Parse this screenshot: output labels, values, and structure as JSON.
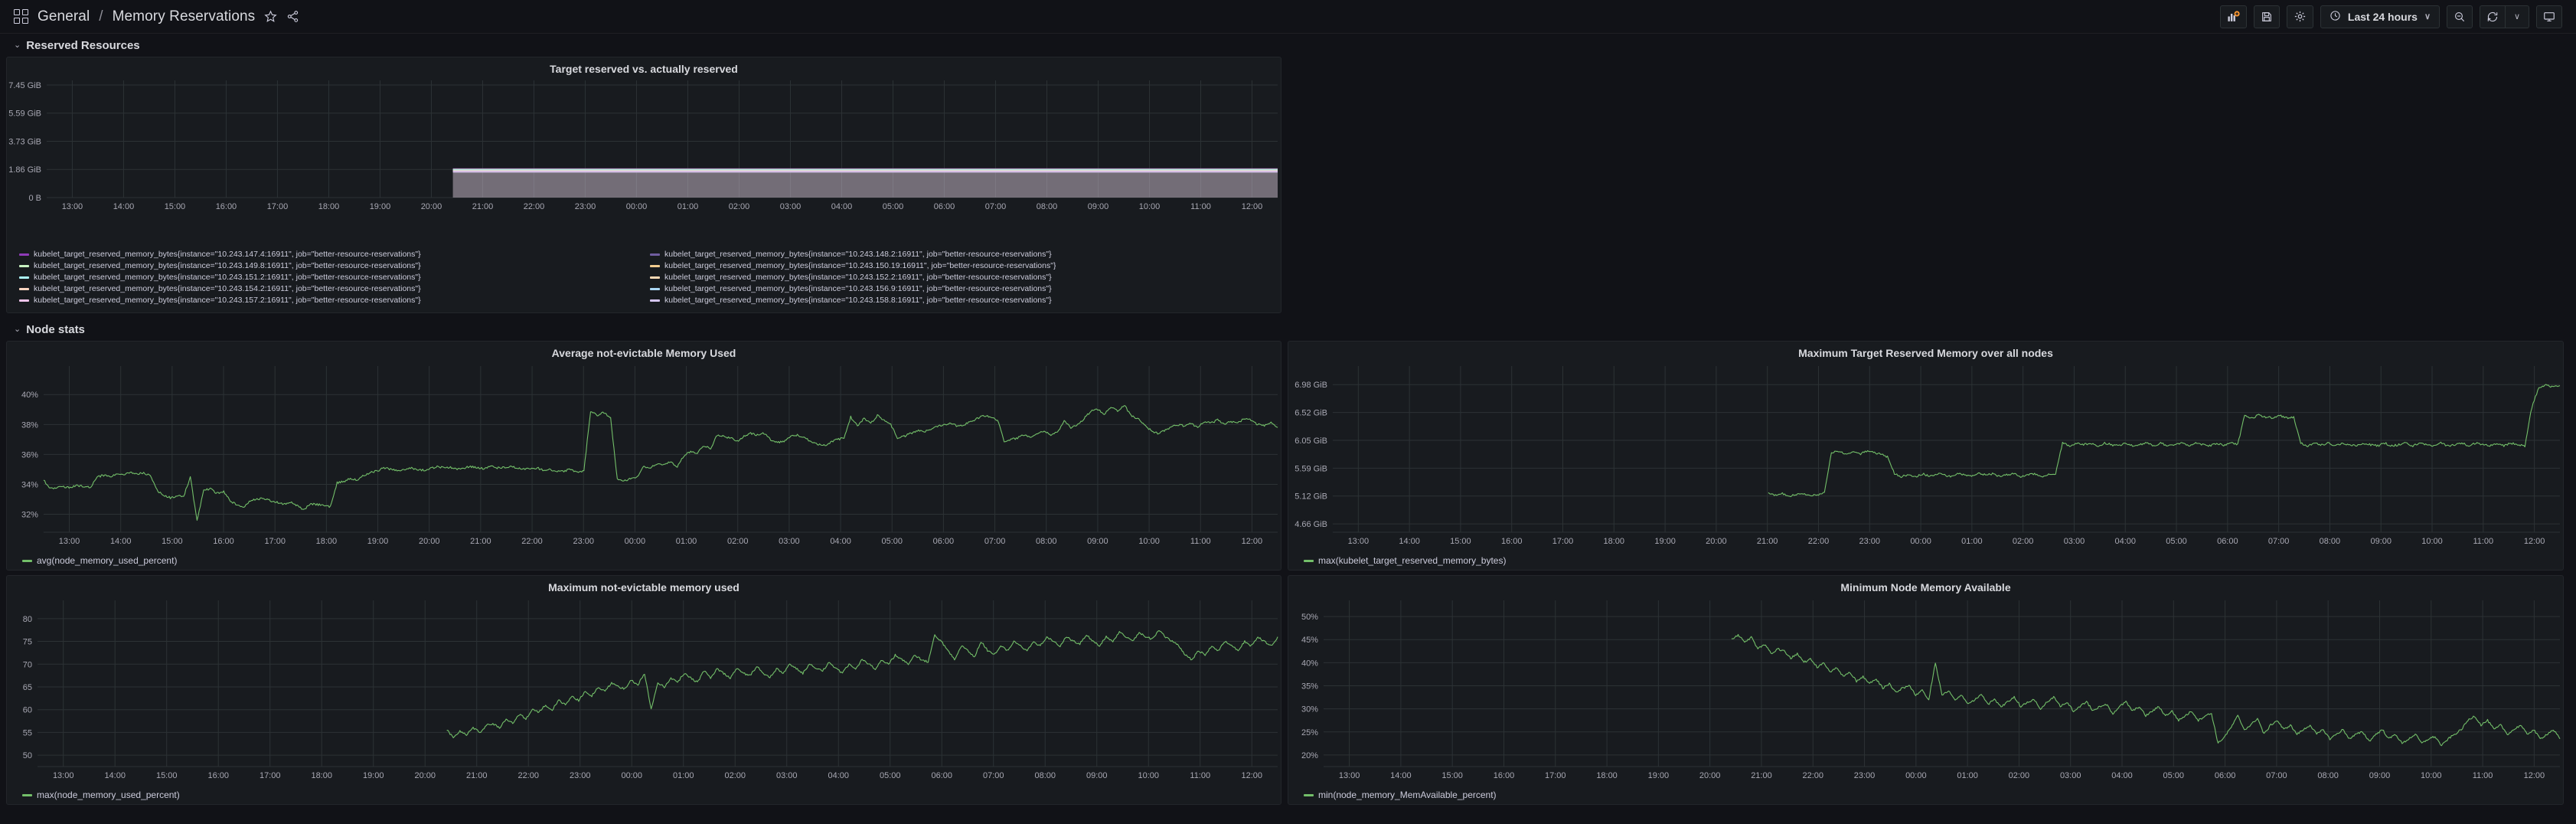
{
  "nav": {
    "grid_icon": "grid-icon",
    "folder": "General",
    "separator": "/",
    "dashboard_title": "Memory Reservations",
    "star_icon": "star-icon",
    "share_icon": "share-icon",
    "buttons": {
      "add_panel": "add-panel-icon",
      "save": "save-icon",
      "settings": "gear-icon",
      "time_range": "Last 24 hours",
      "time_icon": "clock-icon",
      "time_caret": "∨",
      "zoom_out": "zoom-out-icon",
      "refresh": "refresh-icon",
      "refresh_caret": "∨",
      "tv_mode": "tv-icon"
    }
  },
  "rows": [
    {
      "id": "reserved-resources",
      "title": "Reserved Resources",
      "chevron": "⌄"
    },
    {
      "id": "node-stats",
      "title": "Node stats",
      "chevron": "⌄"
    }
  ],
  "colors": {
    "accent_green": "#73bf69",
    "panel_bg": "#181b1f",
    "grid": "#2c3235",
    "text": "#ccccdc",
    "orange": "#eab839"
  },
  "chart_data": [
    {
      "id": "target-reserved",
      "type": "line",
      "title": "Target reserved vs. actually reserved",
      "xlabel": "",
      "ylabel": "",
      "grid": true,
      "legend_position": "bottom",
      "ytick_labels": [
        "7.45 GiB",
        "5.59 GiB",
        "3.73 GiB",
        "1.86 GiB",
        "0 B"
      ],
      "ylim": [
        0,
        8000000000
      ],
      "yticks": [
        8000000000,
        6000000000,
        4000000000,
        2000000000,
        0
      ],
      "xtick_labels": [
        "13:00",
        "14:00",
        "15:00",
        "16:00",
        "17:00",
        "18:00",
        "19:00",
        "20:00",
        "21:00",
        "22:00",
        "23:00",
        "00:00",
        "01:00",
        "02:00",
        "03:00",
        "04:00",
        "05:00",
        "06:00",
        "07:00",
        "08:00",
        "09:00",
        "10:00",
        "11:00",
        "12:00"
      ],
      "series": [
        {
          "name": "kubelet_target_reserved_memory_bytes{instance=\"10.243.147.4:16911\", job=\"better-resource-reservations\"}",
          "color": "#8f3bb8",
          "start_frac": 0.33,
          "value": 2050000000
        },
        {
          "name": "kubelet_target_reserved_memory_bytes{instance=\"10.243.148.2:16911\", job=\"better-resource-reservations\"}",
          "color": "#705da0",
          "start_frac": 0.33,
          "value": 2030000000
        },
        {
          "name": "kubelet_target_reserved_memory_bytes{instance=\"10.243.149.8:16911\", job=\"better-resource-reservations\"}",
          "color": "#c8f2c2",
          "start_frac": 0.33,
          "value": 2070000000
        },
        {
          "name": "kubelet_target_reserved_memory_bytes{instance=\"10.243.150.19:16911\", job=\"better-resource-reservations\"}",
          "color": "#f2cc8f",
          "start_frac": 0.33,
          "value": 2040000000
        },
        {
          "name": "kubelet_target_reserved_memory_bytes{instance=\"10.243.151.2:16911\", job=\"better-resource-reservations\"}",
          "color": "#aaf3f5",
          "start_frac": 0.33,
          "value": 2060000000
        },
        {
          "name": "kubelet_target_reserved_memory_bytes{instance=\"10.243.152.2:16911\", job=\"better-resource-reservations\"}",
          "color": "#f9d9b4",
          "start_frac": 0.33,
          "value": 2035000000
        },
        {
          "name": "kubelet_target_reserved_memory_bytes{instance=\"10.243.154.2:16911\", job=\"better-resource-reservations\"}",
          "color": "#fcd5c1",
          "start_frac": 0.33,
          "value": 2045000000
        },
        {
          "name": "kubelet_target_reserved_memory_bytes{instance=\"10.243.156.9:16911\", job=\"better-resource-reservations\"}",
          "color": "#aad7f5",
          "start_frac": 0.33,
          "value": 2055000000
        },
        {
          "name": "kubelet_target_reserved_memory_bytes{instance=\"10.243.157.2:16911\", job=\"better-resource-reservations\"}",
          "color": "#f0c4ea",
          "start_frac": 0.33,
          "value": 2065000000
        },
        {
          "name": "kubelet_target_reserved_memory_bytes{instance=\"10.243.158.8:16911\", job=\"better-resource-reservations\"}",
          "color": "#d4c5f0",
          "start_frac": 0.33,
          "value": 2025000000
        }
      ]
    },
    {
      "id": "avg-not-evictable",
      "type": "line",
      "title": "Average not-evictable Memory Used",
      "xlabel": "",
      "ylabel": "",
      "grid": true,
      "legend_position": "bottom",
      "ytick_labels": [
        "40%",
        "38%",
        "36%",
        "34%",
        "32%"
      ],
      "yticks": [
        40,
        38,
        36,
        34,
        32
      ],
      "ylim": [
        30.8,
        41.6
      ],
      "xtick_labels": [
        "13:00",
        "14:00",
        "15:00",
        "16:00",
        "17:00",
        "18:00",
        "19:00",
        "20:00",
        "21:00",
        "22:00",
        "23:00",
        "00:00",
        "01:00",
        "02:00",
        "03:00",
        "04:00",
        "05:00",
        "06:00",
        "07:00",
        "08:00",
        "09:00",
        "10:00",
        "11:00",
        "12:00"
      ],
      "series": [
        {
          "name": "avg(node_memory_used_percent)",
          "color": "#73bf69",
          "values": [
            34.3,
            33.7,
            33.8,
            33.85,
            33.8,
            33.9,
            33.85,
            33.8,
            34.5,
            34.6,
            34.5,
            34.7,
            34.6,
            34.8,
            34.7,
            34.75,
            34.6,
            33.6,
            33.3,
            33.1,
            33.2,
            33.2,
            34.5,
            31.6,
            33.6,
            33.7,
            33.4,
            33.5,
            32.9,
            32.6,
            32.5,
            32.9,
            33.0,
            33.05,
            32.9,
            32.8,
            32.7,
            32.8,
            32.6,
            32.3,
            32.7,
            32.65,
            32.6,
            32.5,
            34.1,
            34.2,
            34.4,
            34.3,
            34.6,
            34.8,
            34.9,
            35.1,
            35.0,
            34.9,
            35.0,
            35.1,
            35.0,
            34.95,
            35.05,
            35.2,
            35.1,
            35.15,
            35.0,
            35.1,
            35.2,
            35.1,
            35.05,
            35.2,
            35.1,
            35.15,
            35.2,
            35.1,
            35.05,
            35.0,
            35.1,
            34.9,
            35.0,
            34.85,
            34.9,
            35.0,
            34.8,
            34.9,
            38.9,
            38.6,
            38.8,
            38.4,
            34.4,
            34.2,
            34.4,
            34.5,
            35.2,
            35.1,
            35.4,
            35.3,
            35.5,
            35.2,
            35.9,
            36.2,
            36.1,
            36.6,
            36.4,
            37.3,
            37.2,
            37.1,
            36.9,
            37.2,
            37.4,
            37.3,
            37.4,
            37.0,
            36.8,
            36.9,
            37.2,
            37.3,
            37.1,
            36.9,
            36.7,
            36.6,
            36.8,
            37.0,
            37.1,
            38.5,
            37.9,
            38.4,
            38.1,
            38.6,
            38.3,
            38.0,
            37.1,
            37.2,
            37.4,
            37.6,
            37.5,
            37.7,
            37.9,
            38.0,
            38.1,
            37.9,
            38.0,
            38.2,
            38.4,
            38.6,
            38.5,
            38.3,
            36.9,
            37.0,
            37.1,
            37.3,
            37.2,
            37.4,
            37.6,
            37.3,
            37.5,
            38.2,
            37.8,
            38.0,
            38.4,
            38.9,
            39.0,
            38.7,
            39.2,
            38.9,
            39.3,
            38.6,
            38.4,
            38.0,
            37.6,
            37.4,
            37.6,
            37.8,
            38.0,
            37.9,
            38.1,
            37.8,
            38.2,
            38.1,
            38.3,
            38.0,
            38.2,
            38.1,
            38.4,
            38.3,
            38.0,
            37.9,
            38.1,
            37.8
          ]
        }
      ]
    },
    {
      "id": "max-target-reserved",
      "type": "line",
      "title": "Maximum Target Reserved Memory over all nodes",
      "xlabel": "",
      "ylabel": "",
      "grid": true,
      "legend_position": "bottom",
      "ytick_labels": [
        "6.98 GiB",
        "6.52 GiB",
        "6.05 GiB",
        "5.59 GiB",
        "5.12 GiB",
        "4.66 GiB"
      ],
      "yticks": [
        7.5,
        7.0,
        6.5,
        6.0,
        5.5,
        5.0
      ],
      "ylim": [
        4.85,
        7.75
      ],
      "xtick_labels": [
        "13:00",
        "14:00",
        "15:00",
        "16:00",
        "17:00",
        "18:00",
        "19:00",
        "20:00",
        "21:00",
        "22:00",
        "23:00",
        "00:00",
        "01:00",
        "02:00",
        "03:00",
        "04:00",
        "05:00",
        "06:00",
        "07:00",
        "08:00",
        "09:00",
        "10:00",
        "11:00",
        "12:00"
      ],
      "series": [
        {
          "name": "max(kubelet_target_reserved_memory_bytes)",
          "color": "#73bf69",
          "start_frac": 0.355,
          "values": [
            5.55,
            5.52,
            5.55,
            5.5,
            5.52,
            5.55,
            5.5,
            5.52,
            5.55,
            6.28,
            6.3,
            6.25,
            6.3,
            6.25,
            6.3,
            6.28,
            6.25,
            6.2,
            5.9,
            5.85,
            5.88,
            5.85,
            5.9,
            5.85,
            5.9,
            5.88,
            5.85,
            5.9,
            5.88,
            5.85,
            5.9,
            5.88,
            5.9,
            5.85,
            5.88,
            5.9,
            5.85,
            5.88,
            5.9,
            5.85,
            5.88,
            5.9,
            6.45,
            6.4,
            6.45,
            6.42,
            6.45,
            6.4,
            6.45,
            6.42,
            6.4,
            6.45,
            6.4,
            6.42,
            6.45,
            6.4,
            6.45,
            6.4,
            6.42,
            6.45,
            6.4,
            6.45,
            6.42,
            6.4,
            6.45,
            6.4,
            6.45,
            6.42,
            6.95,
            6.9,
            6.95,
            6.92,
            6.9,
            6.95,
            6.9,
            6.92,
            6.45,
            6.4,
            6.45,
            6.42,
            6.45,
            6.4,
            6.45,
            6.42,
            6.4,
            6.45,
            6.42,
            6.4,
            6.45,
            6.4,
            6.42,
            6.45,
            6.4,
            6.45,
            6.42,
            6.4,
            6.45,
            6.4,
            6.42,
            6.45,
            6.4,
            6.45,
            6.42,
            6.4,
            6.45,
            6.4,
            6.45,
            6.42,
            6.4,
            7.1,
            7.45,
            7.5,
            7.45,
            7.48
          ]
        }
      ]
    },
    {
      "id": "max-not-evictable",
      "type": "line",
      "title": "Maximum not-evictable memory used",
      "xlabel": "",
      "ylabel": "",
      "grid": true,
      "legend_position": "bottom",
      "ytick_labels": [
        "80",
        "75",
        "70",
        "65",
        "60",
        "55",
        "50"
      ],
      "yticks": [
        80,
        75,
        70,
        65,
        60,
        55,
        50
      ],
      "ylim": [
        47.5,
        83
      ],
      "xtick_labels": [
        "13:00",
        "14:00",
        "15:00",
        "16:00",
        "17:00",
        "18:00",
        "19:00",
        "20:00",
        "21:00",
        "22:00",
        "23:00",
        "00:00",
        "01:00",
        "02:00",
        "03:00",
        "04:00",
        "05:00",
        "06:00",
        "07:00",
        "08:00",
        "09:00",
        "10:00",
        "11:00",
        "12:00"
      ],
      "series": [
        {
          "name": "max(node_memory_used_percent)",
          "color": "#73bf69",
          "start_frac": 0.33,
          "values": [
            55.5,
            54.0,
            55.2,
            54.5,
            56.0,
            55.0,
            56.5,
            57.0,
            56.0,
            58.0,
            57.0,
            59.0,
            58.0,
            60.0,
            59.5,
            61.0,
            60.0,
            62.0,
            61.0,
            63.0,
            62.0,
            64.0,
            63.0,
            65.0,
            64.0,
            66.0,
            65.0,
            64.5,
            66.5,
            65.5,
            68.0,
            60.0,
            66.0,
            65.0,
            67.0,
            66.0,
            68.0,
            67.0,
            66.0,
            68.5,
            67.0,
            69.0,
            68.0,
            67.0,
            69.0,
            68.0,
            67.5,
            69.5,
            68.0,
            67.0,
            69.0,
            68.0,
            70.0,
            69.0,
            68.0,
            70.0,
            69.0,
            68.5,
            70.5,
            69.0,
            68.0,
            70.0,
            69.0,
            71.0,
            70.0,
            69.0,
            71.0,
            70.0,
            72.0,
            71.0,
            70.0,
            72.0,
            71.0,
            70.5,
            76.5,
            75.0,
            73.0,
            71.0,
            74.0,
            73.0,
            71.5,
            75.0,
            73.0,
            72.0,
            74.0,
            73.0,
            75.0,
            74.0,
            73.0,
            75.0,
            74.0,
            76.0,
            75.0,
            74.0,
            76.0,
            75.0,
            74.5,
            76.5,
            75.0,
            74.0,
            76.0,
            75.0,
            77.0,
            76.0,
            75.0,
            77.0,
            76.0,
            75.5,
            77.5,
            76.0,
            75.0,
            74.0,
            72.0,
            71.0,
            73.0,
            72.0,
            74.0,
            73.0,
            75.0,
            74.0,
            73.0,
            75.0,
            74.0,
            76.0,
            75.0,
            74.0,
            76.0
          ]
        }
      ]
    },
    {
      "id": "min-node-mem-available",
      "type": "line",
      "title": "Minimum Node Memory Available",
      "xlabel": "",
      "ylabel": "",
      "grid": true,
      "legend_position": "bottom",
      "ytick_labels": [
        "50%",
        "45%",
        "40%",
        "35%",
        "30%",
        "25%",
        "20%"
      ],
      "yticks": [
        50,
        45,
        40,
        35,
        30,
        25,
        20
      ],
      "ylim": [
        17.5,
        52.5
      ],
      "xtick_labels": [
        "13:00",
        "14:00",
        "15:00",
        "16:00",
        "17:00",
        "18:00",
        "19:00",
        "20:00",
        "21:00",
        "22:00",
        "23:00",
        "00:00",
        "01:00",
        "02:00",
        "03:00",
        "04:00",
        "05:00",
        "06:00",
        "07:00",
        "08:00",
        "09:00",
        "10:00",
        "11:00",
        "12:00"
      ],
      "series": [
        {
          "name": "min(node_memory_MemAvailable_percent)",
          "color": "#73bf69",
          "start_frac": 0.33,
          "values": [
            45.0,
            46.0,
            44.5,
            45.5,
            43.0,
            44.0,
            42.0,
            43.0,
            42.5,
            41.0,
            42.0,
            40.0,
            41.0,
            39.0,
            40.0,
            38.0,
            39.0,
            37.0,
            38.0,
            36.0,
            37.0,
            35.5,
            36.5,
            34.5,
            35.5,
            33.5,
            34.5,
            35.0,
            33.0,
            34.0,
            32.0,
            40.0,
            33.0,
            34.0,
            32.0,
            33.0,
            31.0,
            32.0,
            33.0,
            31.0,
            32.0,
            30.5,
            31.5,
            32.5,
            30.5,
            31.5,
            32.0,
            30.0,
            31.5,
            32.5,
            30.5,
            31.5,
            29.5,
            30.5,
            31.5,
            29.5,
            30.5,
            31.0,
            29.0,
            30.5,
            31.5,
            29.5,
            30.5,
            28.5,
            29.5,
            30.5,
            28.5,
            29.5,
            27.5,
            28.5,
            29.5,
            27.5,
            28.5,
            29.0,
            22.5,
            24.0,
            26.0,
            28.5,
            25.5,
            26.5,
            28.0,
            24.5,
            26.5,
            27.5,
            25.5,
            26.5,
            24.5,
            25.5,
            26.5,
            24.5,
            25.5,
            23.5,
            24.5,
            25.5,
            23.5,
            24.5,
            25.0,
            23.0,
            24.5,
            25.5,
            23.5,
            24.5,
            22.5,
            23.5,
            24.5,
            22.5,
            23.5,
            24.0,
            22.0,
            23.5,
            24.5,
            25.5,
            27.5,
            28.5,
            26.5,
            27.5,
            25.5,
            26.5,
            24.5,
            25.5,
            26.5,
            24.5,
            25.5,
            23.5,
            24.5,
            25.5,
            23.5
          ]
        }
      ]
    }
  ]
}
